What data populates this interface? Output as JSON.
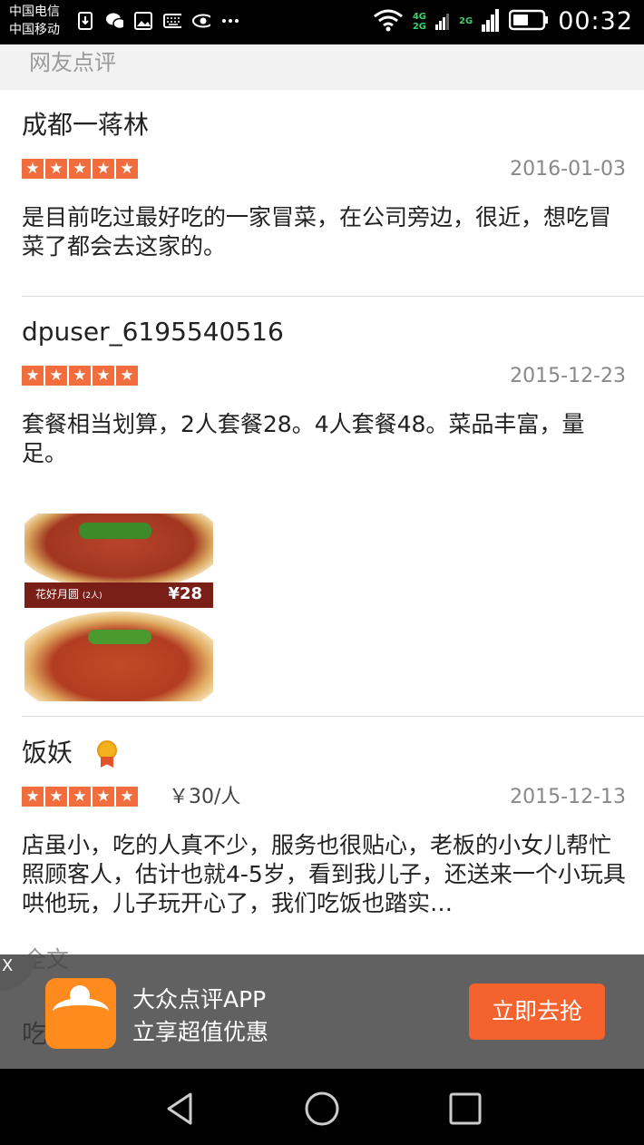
{
  "status_bar": {
    "carrier1": "中国电信",
    "carrier2": "中国移动",
    "net_top": "4G",
    "net_bottom": "2G",
    "net_single": "2G",
    "time": "00:32"
  },
  "section": {
    "title": "网友点评"
  },
  "reviews": [
    {
      "user": "成都一蒋林",
      "stars": 5,
      "date": "2016-01-03",
      "text": "是目前吃过最好吃的一家冒菜，在公司旁边，很近，想吃冒菜了都会去这家的。"
    },
    {
      "user": "dpuser_6195540516",
      "stars": 5,
      "date": "2015-12-23",
      "text": "套餐相当划算，2人套餐28。4人套餐48。菜品丰富，量足。",
      "photo": {
        "caption": "花好月圆",
        "caption_sub": "(2人)",
        "price": "¥28"
      }
    },
    {
      "user": "饭妖",
      "stars": 5,
      "price": "￥30/人",
      "date": "2015-12-13",
      "text": "店虽小，吃的人真不少，服务也很贴心，老板的小女儿帮忙照顾客人，估计也就4-5岁，看到我儿子，还送来一个小玩具哄他玩，儿子玩开心了，我们吃饭也踏实…"
    }
  ],
  "more_link": "全文",
  "next_reviewer_partial": "吃",
  "promo": {
    "close": "X",
    "line1": "大众点评APP",
    "line2": "立享超值优惠",
    "button": "立即去抢",
    "colors": {
      "button": "#f4622e",
      "logo": "#ff8a1e"
    }
  },
  "colors": {
    "star": "#f26d3d",
    "date": "#888888"
  }
}
